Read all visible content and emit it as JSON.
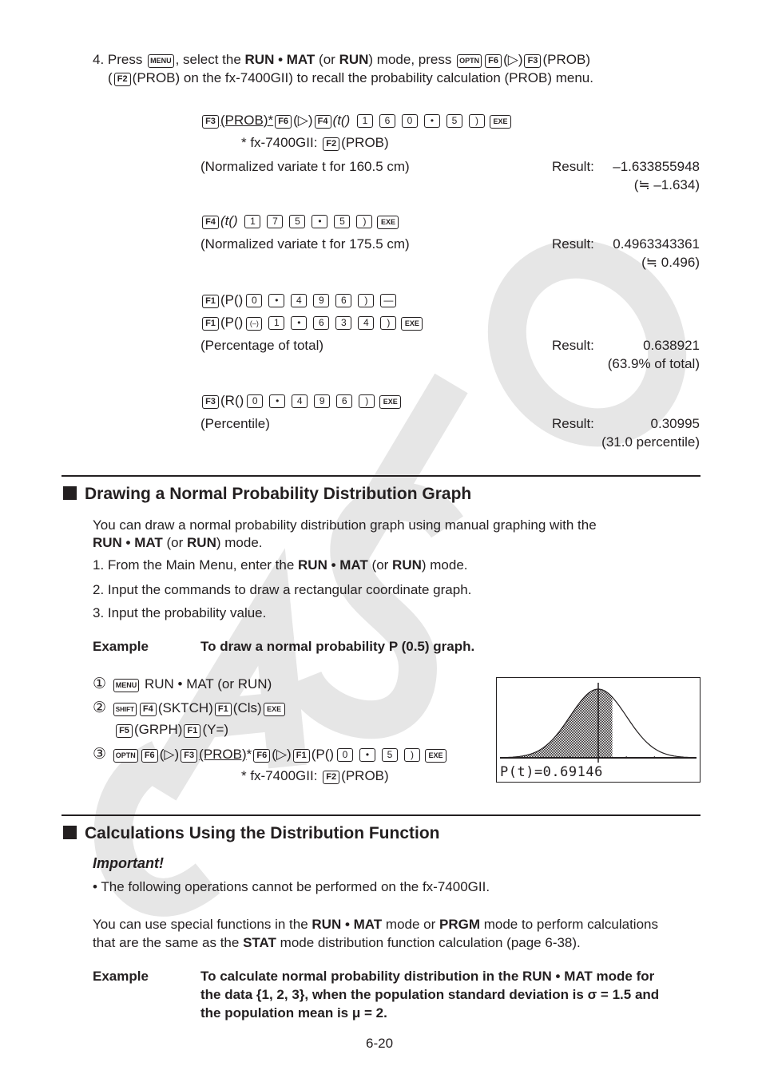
{
  "watermark": "CASIO",
  "step4": {
    "line1": [
      "4. Press ",
      "MENU",
      ", select the ",
      "RUN • MAT",
      " (or ",
      "RUN",
      ") mode, press ",
      "OPTN",
      "F6",
      "(▷)",
      "F3",
      "(PROB)"
    ],
    "line2_pre": "(",
    "line2_key": "F2",
    "line2_text": "(PROB) on the fx-7400GII) to recall the probability calculation (PROB) menu."
  },
  "calc": {
    "t160": {
      "keys_label": "(PROB)*",
      "f6_label": "(▷)",
      "f4_label": "(t()",
      "digits": [
        "1",
        "6",
        "0",
        "•",
        "5",
        ")"
      ],
      "footnote": "* fx-7400GII:",
      "footnote_key": "F2",
      "footnote_label": "(PROB)",
      "desc": "(Normalized variate t for 160.5 cm)",
      "result_label": "Result:",
      "result": "–1.633855948",
      "approx": "(≒ –1.634)"
    },
    "t175": {
      "f4_label": "(t()",
      "digits": [
        "1",
        "7",
        "5",
        "•",
        "5",
        ")"
      ],
      "desc": "(Normalized variate t for 175.5 cm)",
      "result_label": "Result:",
      "result": "0.4963343361",
      "approx": "(≒ 0.496)"
    },
    "p": {
      "f1_label": "(P()",
      "digits1": [
        "0",
        "•",
        "4",
        "9",
        "6",
        ")"
      ],
      "minus_key": "—",
      "neg_key": "(–)",
      "digits2": [
        "1",
        "•",
        "6",
        "3",
        "4",
        ")"
      ],
      "desc": "(Percentage of total)",
      "result_label": "Result:",
      "result": "0.638921",
      "approx": "(63.9% of total)"
    },
    "r": {
      "f3_label": "(R()",
      "digits": [
        "0",
        "•",
        "4",
        "9",
        "6",
        ")"
      ],
      "desc": "(Percentile)",
      "result_label": "Result:",
      "result": "0.30995",
      "approx": "(31.0 percentile)"
    }
  },
  "keys": {
    "menu": "MENU",
    "optn": "OPTN",
    "shift": "SHIFT",
    "exe": "EXE",
    "f1": "F1",
    "f2": "F2",
    "f3": "F3",
    "f4": "F4",
    "f5": "F5",
    "f6": "F6"
  },
  "section1": {
    "title": "Drawing a Normal Probability Distribution Graph",
    "intro1": "You can draw a normal probability distribution graph using manual graphing with the",
    "intro2_b1": "RUN • MAT",
    "intro2_t1": " (or ",
    "intro2_b2": "RUN",
    "intro2_t2": ") mode.",
    "step1_t1": "1. From the Main Menu, enter the ",
    "step1_b1": "RUN • MAT",
    "step1_t2": " (or ",
    "step1_b2": "RUN",
    "step1_t3": ") mode.",
    "step2": "2. Input the commands to draw a rectangular coordinate graph.",
    "step3": "3. Input the probability value.",
    "example_label": "Example",
    "example_text": "To draw a normal probability P (0.5) graph.",
    "op1_num": "①",
    "op1_text": "RUN • MAT (or RUN)",
    "op2_num": "②",
    "op2_sktch": "(SKTCH)",
    "op2_cls": "(Cls)",
    "op2_grph": "(GRPH)",
    "op2_y": "(Y=)",
    "op3_num": "③",
    "op3_f6": "(▷)",
    "op3_prob": "(PROB)",
    "op3_star": "*",
    "op3_f6b": "(▷)",
    "op3_p": "(P()",
    "op3_digits": [
      "0",
      "•",
      "5",
      ")"
    ],
    "op3_footnote": "* fx-7400GII:",
    "op3_footkey": "F2",
    "op3_footlabel": "(PROB)",
    "screen_text": "P(t)=0.69146"
  },
  "section2": {
    "title": "Calculations Using the Distribution Function",
    "important": "Important!",
    "bullet": "• The following operations cannot be performed on the fx-7400GII.",
    "para1_t1": "You can use special functions in the ",
    "para1_b1": "RUN • MAT",
    "para1_t2": " mode or ",
    "para1_b2": "PRGM",
    "para1_t3": " mode to perform calculations",
    "para2_t1": "that are the same as the ",
    "para2_b1": "STAT",
    "para2_t2": " mode distribution function calculation (page 6-38).",
    "example_label": "Example",
    "example_l1": "To calculate normal probability distribution in the RUN • MAT mode for",
    "example_l2": "the data {1, 2, 3}, when the population standard deviation is σ = 1.5 and",
    "example_l3": "the population mean is μ = 2."
  },
  "page_number": "6-20",
  "chart_data": {
    "type": "area",
    "title": "",
    "description": "Standard normal density curve with shaded area from left to t = 0.5",
    "x_range": [
      -3.5,
      3.5
    ],
    "shade_upper_t": 0.5,
    "result_label": "P(t)=0.69146",
    "result_value": 0.69146
  }
}
